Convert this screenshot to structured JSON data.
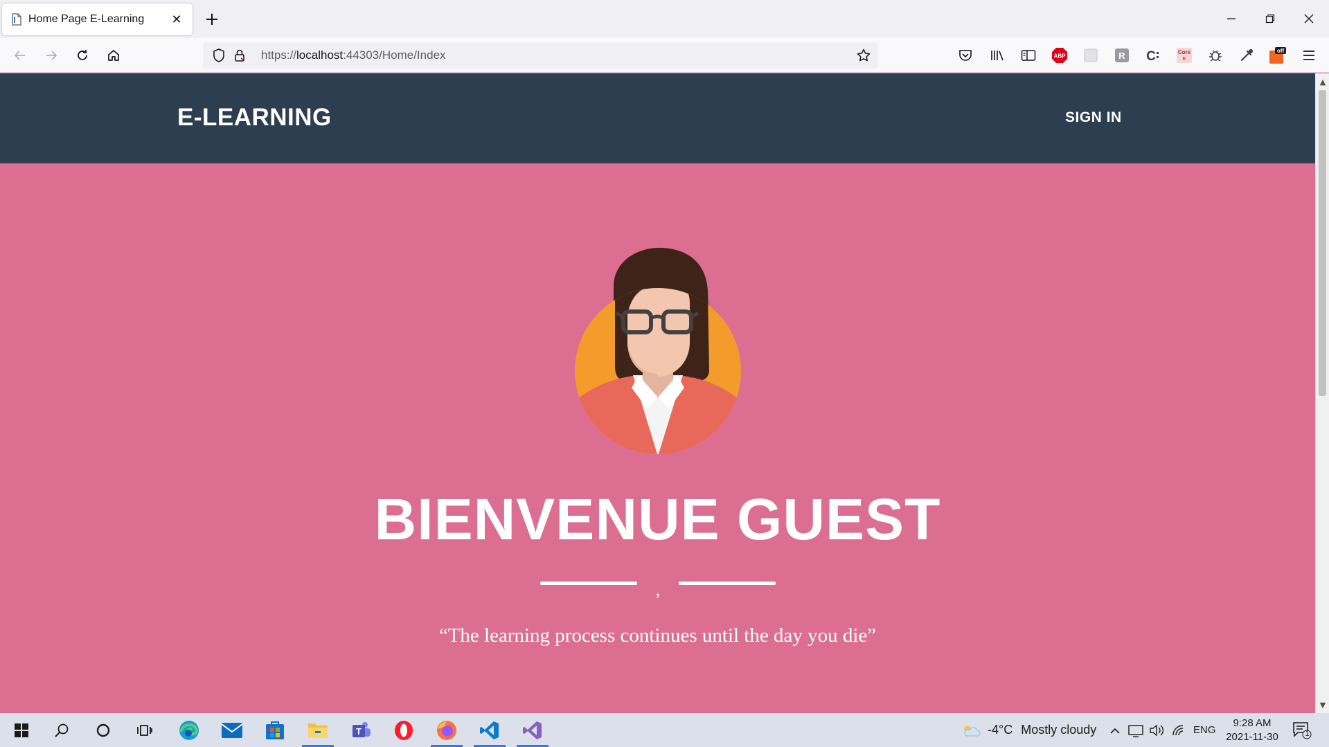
{
  "browser": {
    "tab": {
      "title": "Home Page E-Learning",
      "close_glyph": "✕"
    },
    "new_tab_glyph": "+",
    "url": {
      "scheme": "https://",
      "host": "localhost",
      "rest": ":44303/Home/Index"
    },
    "extensions": [
      {
        "icon": "pocket-icon"
      },
      {
        "icon": "library-icon"
      },
      {
        "icon": "sidebar-icon"
      },
      {
        "icon": "adblock-plus-icon",
        "label": "ABP"
      },
      {
        "icon": "extension-blank-icon"
      },
      {
        "icon": "extension-r-icon",
        "label": "R"
      },
      {
        "icon": "extension-c-icon",
        "label": "C"
      },
      {
        "icon": "cors-icon",
        "label": "Cors"
      },
      {
        "icon": "bug-icon"
      },
      {
        "icon": "eyedropper-icon"
      },
      {
        "icon": "off-toggle-icon",
        "label": "off"
      },
      {
        "icon": "menu-icon"
      }
    ],
    "accent": "#0060df"
  },
  "site": {
    "brand": "E-LEARNING",
    "signin": "SIGN IN",
    "header_color": "#2c3e50",
    "hero_color": "#dc6e92",
    "welcome": "BIENVENUE GUEST",
    "divider_mark": ",",
    "quote": "“The learning process continues until the day you die”"
  },
  "taskbar": {
    "apps": [
      {
        "icon": "windows-start-icon"
      },
      {
        "icon": "search-icon"
      },
      {
        "icon": "cortana-icon"
      },
      {
        "icon": "task-view-icon"
      },
      {
        "icon": "edge-icon"
      },
      {
        "icon": "mail-icon"
      },
      {
        "icon": "store-icon"
      },
      {
        "icon": "file-explorer-icon"
      },
      {
        "icon": "teams-icon"
      },
      {
        "icon": "opera-icon"
      },
      {
        "icon": "firefox-icon"
      },
      {
        "icon": "vscode-icon"
      },
      {
        "icon": "visual-studio-icon"
      }
    ],
    "weather": {
      "temp": "-4°C",
      "text": "Mostly cloudy"
    },
    "lang": "ENG",
    "time": "9:28 AM",
    "date": "2021-11-30",
    "notifications": "1"
  }
}
